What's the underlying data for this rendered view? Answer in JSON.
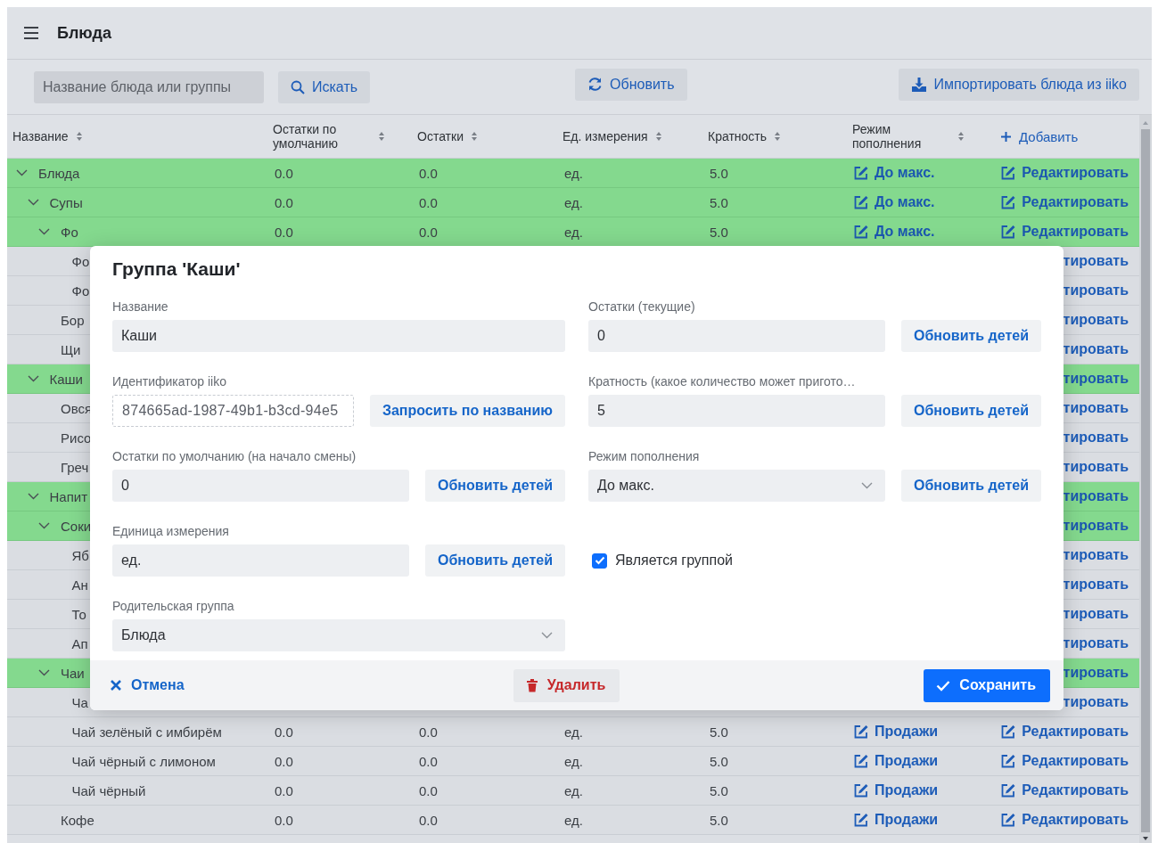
{
  "header": {
    "title": "Блюда"
  },
  "toolbar": {
    "search": {
      "placeholder": "Название блюда или группы"
    },
    "search_button": "Искать",
    "refresh_button": "Обновить",
    "import_button": "Импортировать блюда из iiko"
  },
  "table": {
    "columns": [
      {
        "label": "Название",
        "sortable": true
      },
      {
        "label": "Остатки по умолчанию",
        "sortable": true
      },
      {
        "label": "Остатки",
        "sortable": true
      },
      {
        "label": "Ед. измерения",
        "sortable": true
      },
      {
        "label": "Кратность",
        "sortable": true
      },
      {
        "label": "Режим пополнения",
        "sortable": true
      }
    ],
    "add_link": "Добавить",
    "rows": [
      {
        "name": "Блюда",
        "kind": "group",
        "expanded": true,
        "default_stock": "0.0",
        "stock": "0.0",
        "unit": "ед.",
        "multiplicity": "5.0",
        "mode": "До макс.",
        "action": "Редактировать",
        "children": [
          {
            "name": "Супы",
            "kind": "group",
            "expanded": true,
            "default_stock": "0.0",
            "stock": "0.0",
            "unit": "ед.",
            "multiplicity": "5.0",
            "mode": "До макс.",
            "action": "Редактировать",
            "children": [
              {
                "name": "Фо",
                "kind": "group",
                "expanded": true,
                "default_stock": "0.0",
                "stock": "0.0",
                "unit": "ед.",
                "multiplicity": "5.0",
                "mode": "До макс.",
                "action": "Редактировать",
                "children": [
                  {
                    "name": "Фо",
                    "kind": "item",
                    "action": "тировать"
                  },
                  {
                    "name": "Фо",
                    "kind": "item",
                    "action": "тировать"
                  }
                ]
              },
              {
                "name": "Бор",
                "kind": "item",
                "action": "тировать"
              },
              {
                "name": "Щи",
                "kind": "item",
                "action": "тировать"
              }
            ]
          },
          {
            "name": "Каши",
            "kind": "group",
            "expanded": true,
            "action": "тировать",
            "children": [
              {
                "name": "Овся",
                "kind": "item",
                "action": "тировать"
              },
              {
                "name": "Рисо",
                "kind": "item",
                "action": "тировать"
              },
              {
                "name": "Греч",
                "kind": "item",
                "action": "тировать"
              }
            ]
          },
          {
            "name": "Напит",
            "kind": "group",
            "expanded": true,
            "action": "тировать",
            "children": [
              {
                "name": "Соки",
                "kind": "group",
                "expanded": true,
                "action": "тировать",
                "children": [
                  {
                    "name": "Яб",
                    "kind": "item",
                    "action": "тировать"
                  },
                  {
                    "name": "Ан",
                    "kind": "item",
                    "action": "тировать"
                  },
                  {
                    "name": "То",
                    "kind": "item",
                    "action": "тировать"
                  },
                  {
                    "name": "Ап",
                    "kind": "item",
                    "action": "тировать"
                  }
                ]
              },
              {
                "name": "Чаи",
                "kind": "group",
                "expanded": true,
                "action": "тировать",
                "children": [
                  {
                    "name": "Ча",
                    "kind": "item",
                    "action": "тировать"
                  },
                  {
                    "name": "Чай зелёный с имбирём",
                    "kind": "item",
                    "default_stock": "0.0",
                    "stock": "0.0",
                    "unit": "ед.",
                    "multiplicity": "5.0",
                    "mode": "Продажи",
                    "action": "Редактировать"
                  },
                  {
                    "name": "Чай чёрный с лимоном",
                    "kind": "item",
                    "default_stock": "0.0",
                    "stock": "0.0",
                    "unit": "ед.",
                    "multiplicity": "5.0",
                    "mode": "Продажи",
                    "action": "Редактировать"
                  },
                  {
                    "name": "Чай чёрный",
                    "kind": "item",
                    "default_stock": "0.0",
                    "stock": "0.0",
                    "unit": "ед.",
                    "multiplicity": "5.0",
                    "mode": "Продажи",
                    "action": "Редактировать"
                  }
                ]
              },
              {
                "name": "Кофе",
                "kind": "item",
                "default_stock": "0.0",
                "stock": "0.0",
                "unit": "ед.",
                "multiplicity": "5.0",
                "mode": "Продажи",
                "action": "Редактировать"
              }
            ]
          }
        ]
      }
    ]
  },
  "dialog": {
    "title": "Группа 'Каши'",
    "left_fields": [
      {
        "kind": "input",
        "label": "Название",
        "value": "Каши"
      },
      {
        "kind": "id",
        "label": "Идентификатор iiko",
        "value": "874665ad-1987-49b1-b3cd-94e5",
        "button": "Запросить по названию"
      },
      {
        "kind": "input",
        "label": "Остатки по умолчанию (на начало смены)",
        "value": "0",
        "button": "Обновить детей"
      },
      {
        "kind": "input",
        "label": "Единица измерения",
        "value": "ед.",
        "button": "Обновить детей"
      },
      {
        "kind": "select",
        "label": "Родительская группа",
        "value": "Блюда"
      }
    ],
    "right_fields": [
      {
        "kind": "input",
        "label": "Остатки (текущие)",
        "value": "0",
        "button": "Обновить детей"
      },
      {
        "kind": "input",
        "label": "Кратность (какое количество может пригото…",
        "value": "5",
        "button": "Обновить детей"
      },
      {
        "kind": "select",
        "label": "Режим пополнения",
        "value": "До макс.",
        "button": "Обновить детей"
      },
      {
        "kind": "checkbox",
        "label": "Является группой",
        "checked": true
      }
    ],
    "cancel_button": "Отмена",
    "delete_button": "Удалить",
    "save_button": "Сохранить"
  }
}
